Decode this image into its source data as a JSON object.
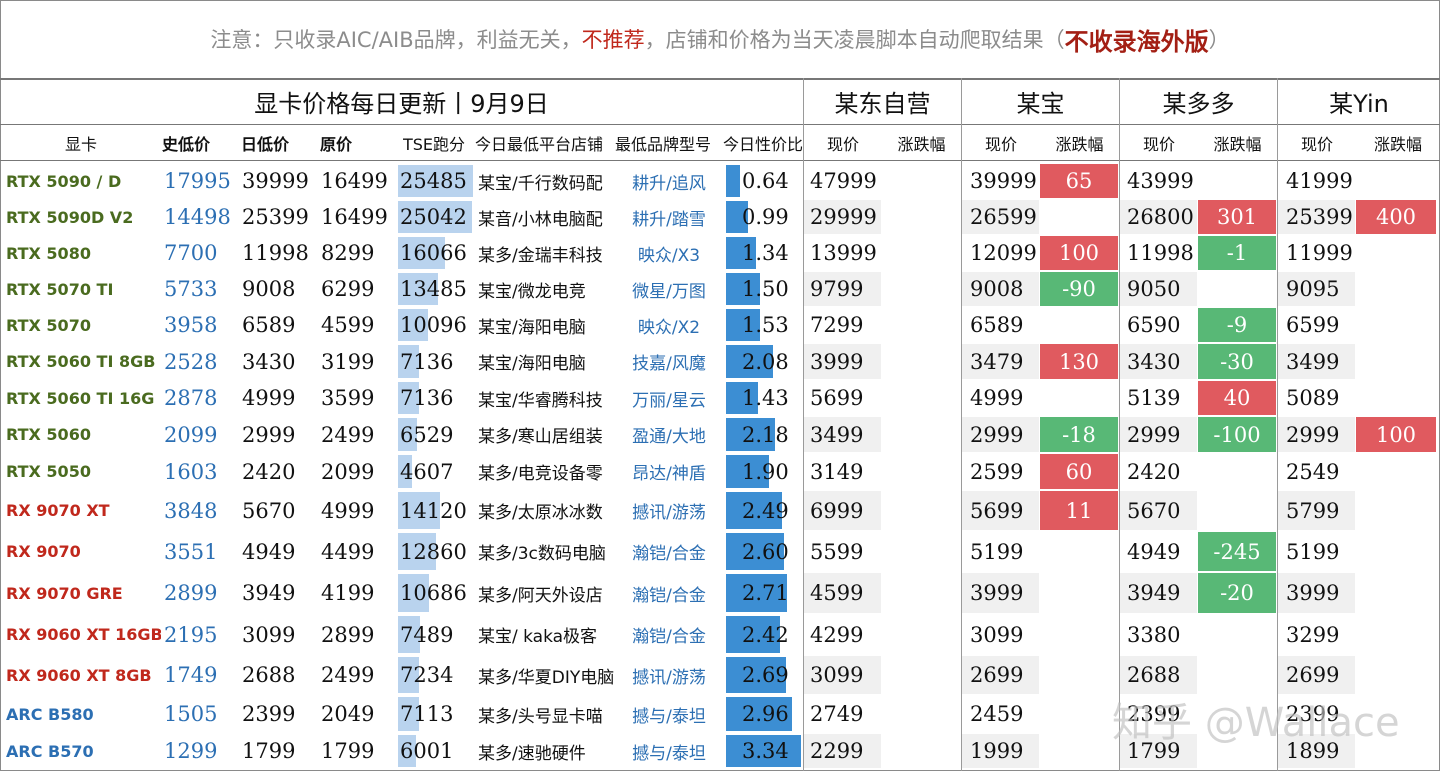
{
  "notice": {
    "part1": "注意：只收录AIC/AIB品牌，利益无关，",
    "not_recommended": "不推荐",
    "part2": "，店铺和价格为当天凌晨脚本自动爬取结果（",
    "no_overseas": "不收录海外版",
    "close": "）"
  },
  "title": "显卡价格每日更新丨9月9日",
  "platforms": [
    "某东自营",
    "某宝",
    "某多多",
    "某Yin"
  ],
  "columns": {
    "gpu": "显卡",
    "hist_low": "史低价",
    "day_low": "日低价",
    "msrp": "原价",
    "tse": "TSE跑分",
    "store": "今日最低平台店铺",
    "model": "最低品牌型号",
    "value": "今日性价比",
    "now": "现价",
    "change": "涨跌幅"
  },
  "colors": {
    "nvidia": "#4a6b1f",
    "amd": "#c0281c",
    "intel": "#2c6fb3",
    "rise": "#e05a5f",
    "fall": "#58b876"
  },
  "rows": [
    {
      "gpu": "RTX 5090 / D",
      "brand": "nvidia",
      "hist_low": "17995",
      "day_low": "39999",
      "msrp": "16499",
      "tse": "25485",
      "store": "某宝/千行数码配",
      "model": "耕升/追风",
      "value": "0.64",
      "jd": "47999",
      "jd_chg": "",
      "tb": "39999",
      "tb_chg": "65",
      "pdd": "43999",
      "pdd_chg": "",
      "dy": "41999",
      "dy_chg": ""
    },
    {
      "gpu": "RTX 5090D V2",
      "brand": "nvidia",
      "hist_low": "14498",
      "day_low": "25399",
      "msrp": "16499",
      "tse": "25042",
      "store": "某音/小林电脑配",
      "model": "耕升/踏雪",
      "value": "0.99",
      "jd": "29999",
      "jd_chg": "",
      "tb": "26599",
      "tb_chg": "",
      "pdd": "26800",
      "pdd_chg": "301",
      "dy": "25399",
      "dy_chg": "400"
    },
    {
      "gpu": "RTX 5080",
      "brand": "nvidia",
      "hist_low": "7700",
      "day_low": "11998",
      "msrp": "8299",
      "tse": "16066",
      "store": "某多/金瑞丰科技",
      "model": "映众/X3",
      "value": "1.34",
      "jd": "13999",
      "jd_chg": "",
      "tb": "12099",
      "tb_chg": "100",
      "pdd": "11998",
      "pdd_chg": "-1",
      "dy": "11999",
      "dy_chg": ""
    },
    {
      "gpu": "RTX 5070 TI",
      "brand": "nvidia",
      "hist_low": "5733",
      "day_low": "9008",
      "msrp": "6299",
      "tse": "13485",
      "store": "某宝/微龙电竞",
      "model": "微星/万图",
      "value": "1.50",
      "jd": "9799",
      "jd_chg": "",
      "tb": "9008",
      "tb_chg": "-90",
      "pdd": "9050",
      "pdd_chg": "",
      "dy": "9095",
      "dy_chg": ""
    },
    {
      "gpu": "RTX 5070",
      "brand": "nvidia",
      "hist_low": "3958",
      "day_low": "6589",
      "msrp": "4599",
      "tse": "10096",
      "store": "某宝/海阳电脑",
      "model": "映众/X2",
      "value": "1.53",
      "jd": "7299",
      "jd_chg": "",
      "tb": "6589",
      "tb_chg": "",
      "pdd": "6590",
      "pdd_chg": "-9",
      "dy": "6599",
      "dy_chg": ""
    },
    {
      "gpu": "RTX 5060 TI 8GB",
      "brand": "nvidia",
      "hist_low": "2528",
      "day_low": "3430",
      "msrp": "3199",
      "tse": "7136",
      "store": "某宝/海阳电脑",
      "model": "技嘉/风魔",
      "value": "2.08",
      "jd": "3999",
      "jd_chg": "",
      "tb": "3479",
      "tb_chg": "130",
      "pdd": "3430",
      "pdd_chg": "-30",
      "dy": "3499",
      "dy_chg": ""
    },
    {
      "gpu": "RTX 5060 TI 16G",
      "brand": "nvidia",
      "hist_low": "2878",
      "day_low": "4999",
      "msrp": "3599",
      "tse": "7136",
      "store": "某宝/华睿腾科技",
      "model": "万丽/星云",
      "value": "1.43",
      "jd": "5699",
      "jd_chg": "",
      "tb": "4999",
      "tb_chg": "",
      "pdd": "5139",
      "pdd_chg": "40",
      "dy": "5089",
      "dy_chg": ""
    },
    {
      "gpu": "RTX 5060",
      "brand": "nvidia",
      "hist_low": "2099",
      "day_low": "2999",
      "msrp": "2499",
      "tse": "6529",
      "store": "某多/寒山居组装",
      "model": "盈通/大地",
      "value": "2.18",
      "jd": "3499",
      "jd_chg": "",
      "tb": "2999",
      "tb_chg": "-18",
      "pdd": "2999",
      "pdd_chg": "-100",
      "dy": "2999",
      "dy_chg": "100"
    },
    {
      "gpu": "RTX 5050",
      "brand": "nvidia",
      "hist_low": "1603",
      "day_low": "2420",
      "msrp": "2099",
      "tse": "4607",
      "store": "某多/电竞设备零",
      "model": "昂达/神盾",
      "value": "1.90",
      "jd": "3149",
      "jd_chg": "",
      "tb": "2599",
      "tb_chg": "60",
      "pdd": "2420",
      "pdd_chg": "",
      "dy": "2549",
      "dy_chg": ""
    },
    {
      "gpu": "RX 9070 XT",
      "brand": "amd",
      "hist_low": "3848",
      "day_low": "5670",
      "msrp": "4999",
      "tse": "14120",
      "store": "某多/太原冰冰数",
      "model": "撼讯/游荡",
      "value": "2.49",
      "jd": "6999",
      "jd_chg": "",
      "tb": "5699",
      "tb_chg": "11",
      "pdd": "5670",
      "pdd_chg": "",
      "dy": "5799",
      "dy_chg": ""
    },
    {
      "gpu": "RX 9070",
      "brand": "amd",
      "hist_low": "3551",
      "day_low": "4949",
      "msrp": "4499",
      "tse": "12860",
      "store": "某多/3c数码电脑",
      "model": "瀚铠/合金",
      "value": "2.60",
      "jd": "5599",
      "jd_chg": "",
      "tb": "5199",
      "tb_chg": "",
      "pdd": "4949",
      "pdd_chg": "-245",
      "dy": "5199",
      "dy_chg": ""
    },
    {
      "gpu": "RX 9070 GRE",
      "brand": "amd",
      "hist_low": "2899",
      "day_low": "3949",
      "msrp": "4199",
      "tse": "10686",
      "store": "某多/阿天外设店",
      "model": "瀚铠/合金",
      "value": "2.71",
      "jd": "4599",
      "jd_chg": "",
      "tb": "3999",
      "tb_chg": "",
      "pdd": "3949",
      "pdd_chg": "-20",
      "dy": "3999",
      "dy_chg": ""
    },
    {
      "gpu": "RX 9060 XT 16GB",
      "brand": "amd",
      "hist_low": "2195",
      "day_low": "3099",
      "msrp": "2899",
      "tse": "7489",
      "store": "某宝/ kaka极客",
      "model": "瀚铠/合金",
      "value": "2.42",
      "jd": "4299",
      "jd_chg": "",
      "tb": "3099",
      "tb_chg": "",
      "pdd": "3380",
      "pdd_chg": "",
      "dy": "3299",
      "dy_chg": ""
    },
    {
      "gpu": "RX 9060 XT 8GB",
      "brand": "amd",
      "hist_low": "1749",
      "day_low": "2688",
      "msrp": "2499",
      "tse": "7234",
      "store": "某多/华夏DIY电脑",
      "model": "撼讯/游荡",
      "value": "2.69",
      "jd": "3099",
      "jd_chg": "",
      "tb": "2699",
      "tb_chg": "",
      "pdd": "2688",
      "pdd_chg": "",
      "dy": "2699",
      "dy_chg": ""
    },
    {
      "gpu": "ARC B580",
      "brand": "intel",
      "hist_low": "1505",
      "day_low": "2399",
      "msrp": "2049",
      "tse": "7113",
      "store": "某多/头号显卡喵",
      "model": "撼与/泰坦",
      "value": "2.96",
      "jd": "2749",
      "jd_chg": "",
      "tb": "2459",
      "tb_chg": "",
      "pdd": "2399",
      "pdd_chg": "",
      "dy": "2399",
      "dy_chg": ""
    },
    {
      "gpu": "ARC B570",
      "brand": "intel",
      "hist_low": "1299",
      "day_low": "1799",
      "msrp": "1799",
      "tse": "6001",
      "store": "某多/速驰硬件",
      "model": "撼与/泰坦",
      "value": "3.34",
      "jd": "2299",
      "jd_chg": "",
      "tb": "1999",
      "tb_chg": "",
      "pdd": "1799",
      "pdd_chg": "",
      "dy": "1899",
      "dy_chg": ""
    }
  ],
  "watermark": "知乎 @Wallace"
}
